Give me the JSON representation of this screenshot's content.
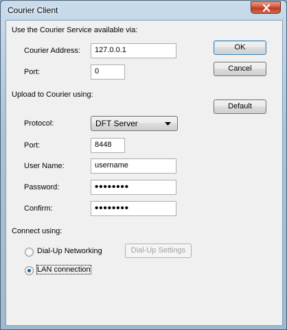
{
  "window": {
    "title": "Courier Client"
  },
  "service": {
    "heading": "Use the Courier Service available via:",
    "address_label": "Courier Address:",
    "address_value": "127.0.0.1",
    "port_label": "Port:",
    "port_value": "0"
  },
  "upload": {
    "heading": "Upload to Courier using:",
    "protocol_label": "Protocol:",
    "protocol_value": "DFT Server",
    "port_label": "Port:",
    "port_value": "8448",
    "username_label": "User Name:",
    "username_value": "username",
    "password_label": "Password:",
    "password_value": "••••••••",
    "confirm_label": "Confirm:",
    "confirm_value": "••••••••"
  },
  "connect": {
    "heading": "Connect using:",
    "dialup_label": "Dial-Up Networking",
    "dialup_settings_label": "Dial-Up Settings",
    "lan_label": "LAN connection",
    "selected": "LAN connection"
  },
  "buttons": {
    "ok": "OK",
    "cancel": "Cancel",
    "default": "Default"
  },
  "icons": {
    "close": "close-icon",
    "dropdown": "chevron-down-icon",
    "radio": "radio-icon"
  },
  "colors": {
    "close_button": "#c94a30",
    "dialog_bg": "#f0f0f0",
    "radio_dot": "#1e5fa8"
  }
}
